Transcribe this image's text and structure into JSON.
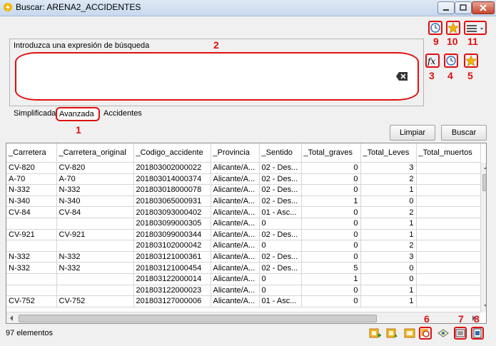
{
  "window": {
    "title": "Buscar: ARENA2_ACCIDENTES"
  },
  "toolbar": {
    "history_icon": "clock-icon",
    "favorites_icon": "star-icon",
    "menu_icon": "hamburger-menu-icon"
  },
  "search": {
    "label": "Introduzca una expresión de búsqueda",
    "value": "",
    "side_icons": [
      "function-fx-icon",
      "clock-icon",
      "star-icon"
    ]
  },
  "tabs": [
    {
      "label": "Simplificada",
      "active": false
    },
    {
      "label": "Avanzada",
      "active": true
    },
    {
      "label": "Accidentes",
      "active": false
    }
  ],
  "buttons": {
    "clear": "Limpiar",
    "search": "Buscar"
  },
  "table": {
    "columns": [
      "_Carretera",
      "_Carretera_original",
      "_Codigo_accidente",
      "_Provincia",
      "_Sentido",
      "_Total_graves",
      "_Total_Leves",
      "_Total_muertos"
    ],
    "rows": [
      [
        "CV-820",
        "CV-820",
        "201803002000022",
        "Alicante/A...",
        "02 - Des...",
        "0",
        "3",
        ""
      ],
      [
        "A-70",
        "A-70",
        "201803014000374",
        "Alicante/A...",
        "02 - Des...",
        "0",
        "2",
        ""
      ],
      [
        "N-332",
        "N-332",
        "201803018000078",
        "Alicante/A...",
        "02 - Des...",
        "0",
        "1",
        ""
      ],
      [
        "N-340",
        "N-340",
        "201803065000931",
        "Alicante/A...",
        "02 - Des...",
        "1",
        "0",
        ""
      ],
      [
        "CV-84",
        "CV-84",
        "201803093000402",
        "Alicante/A...",
        "01 - Asc...",
        "0",
        "2",
        ""
      ],
      [
        "",
        "",
        "201803099000305",
        "Alicante/A...",
        "0",
        "0",
        "1",
        ""
      ],
      [
        "CV-921",
        "CV-921",
        "201803099000344",
        "Alicante/A...",
        "02 - Des...",
        "0",
        "1",
        ""
      ],
      [
        "",
        "",
        "201803102000042",
        "Alicante/A...",
        "0",
        "0",
        "2",
        ""
      ],
      [
        "N-332",
        "N-332",
        "201803121000361",
        "Alicante/A...",
        "02 - Des...",
        "0",
        "3",
        ""
      ],
      [
        "N-332",
        "N-332",
        "201803121000454",
        "Alicante/A...",
        "02 - Des...",
        "5",
        "0",
        ""
      ],
      [
        "",
        "",
        "201803122000014",
        "Alicante/A...",
        "0",
        "1",
        "0",
        ""
      ],
      [
        "",
        "",
        "201803122000023",
        "Alicante/A...",
        "0",
        "0",
        "1",
        ""
      ],
      [
        "CV-752",
        "CV-752",
        "201803127000006",
        "Alicante/A...",
        "01 - Asc...",
        "0",
        "1",
        ""
      ]
    ]
  },
  "status": {
    "count_text": "97 elementos"
  },
  "bottom_icons": [
    "add-layer-icon",
    "add-layer-alt-icon",
    "layer-icon",
    "zoom-icon",
    "select-icon",
    "export-icon",
    "report-icon"
  ],
  "annotations": [
    "1",
    "2",
    "3",
    "4",
    "5",
    "6",
    "7",
    "8",
    "9",
    "10",
    "11"
  ],
  "colors": {
    "annotation_red": "#e01010",
    "title_bar": "#dfe9f5"
  }
}
